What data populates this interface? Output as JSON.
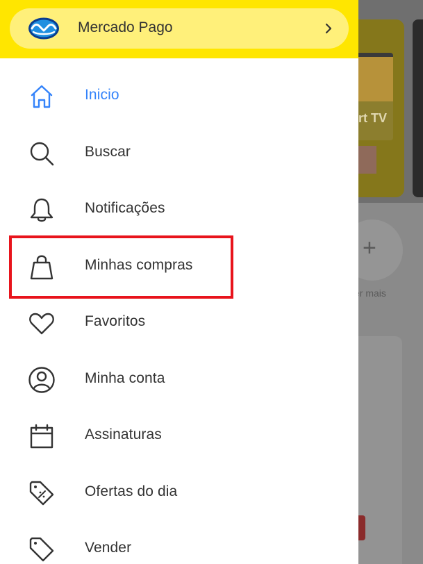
{
  "header": {
    "mercado_pago_label": "Mercado Pago",
    "chevron_icon": "chevron-right-icon",
    "brand_yellow": "#ffe600",
    "pill_color": "#fff07a"
  },
  "menu": {
    "items": [
      {
        "label": "Inicio",
        "icon": "home-icon",
        "active": true
      },
      {
        "label": "Buscar",
        "icon": "search-icon",
        "active": false
      },
      {
        "label": "Notificações",
        "icon": "bell-icon",
        "active": false
      },
      {
        "label": "Minhas compras",
        "icon": "shopping-bag-icon",
        "active": false
      },
      {
        "label": "Favoritos",
        "icon": "heart-icon",
        "active": false
      },
      {
        "label": "Minha conta",
        "icon": "user-icon",
        "active": false
      },
      {
        "label": "Assinaturas",
        "icon": "calendar-icon",
        "active": false
      },
      {
        "label": "Ofertas do dia",
        "icon": "tag-percent-icon",
        "active": false
      },
      {
        "label": "Vender",
        "icon": "tag-icon",
        "active": false
      }
    ],
    "active_color": "#3483fa",
    "text_color": "#333333"
  },
  "annotation": {
    "highlight_color": "#e8141c",
    "highlighted_item": "Minhas compras"
  },
  "background": {
    "banner_text": "rt TV",
    "more_label": "er mais",
    "plus_symbol": "+"
  }
}
